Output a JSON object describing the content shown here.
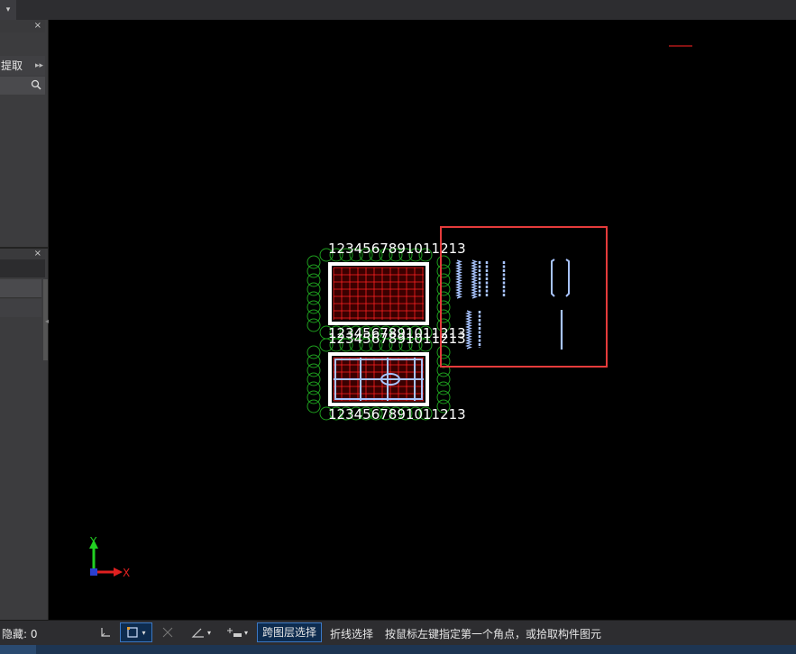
{
  "left_panel": {
    "close_glyph": "×",
    "tab_label": "提取",
    "tab_arrow": "▸▸"
  },
  "canvas": {
    "ucs": {
      "y_label": "Y",
      "x_label": "X"
    },
    "drawing": {
      "column_numbers": "1234567891011213",
      "colors": {
        "grid_red": "#ff2020",
        "frame_white": "#ffffff",
        "bubble_green": "#1e9e1e",
        "rebar_blue": "#a8c4ff",
        "selection_red": "#e53b3b"
      }
    }
  },
  "statusbar": {
    "hidden_label": "隐藏: 0",
    "cross_layer_select": "跨图层选择",
    "polyline_select": "折线选择",
    "prompt": "按鼠标左键指定第一个角点，或拾取构件图元"
  }
}
